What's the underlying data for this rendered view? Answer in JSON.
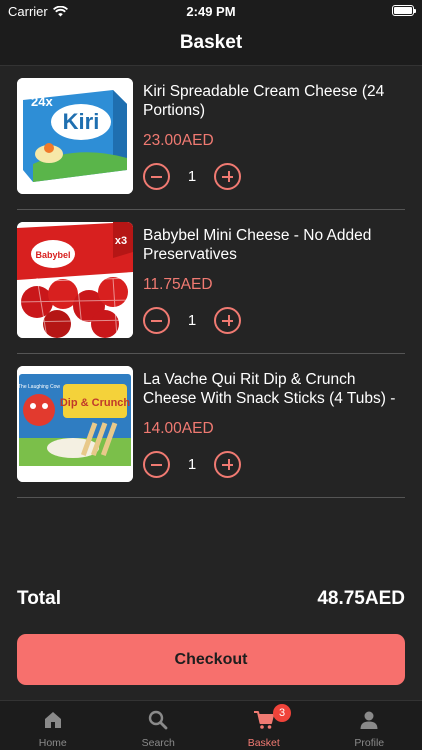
{
  "status_bar": {
    "carrier": "Carrier",
    "time": "2:49 PM"
  },
  "header": {
    "title": "Basket"
  },
  "items": [
    {
      "name": "Kiri Spreadable Cream Cheese (24 Portions)",
      "price": "23.00AED",
      "quantity": "1",
      "image_text": "Kiri",
      "image_badge": "24x"
    },
    {
      "name": "Babybel Mini Cheese - No Added Preservatives",
      "price": "11.75AED",
      "quantity": "1",
      "image_text": "Babybel",
      "image_badge": "x3"
    },
    {
      "name": "La Vache Qui Rit Dip & Crunch Cheese With Snack Sticks (4 Tubs) -",
      "price": "14.00AED",
      "quantity": "1",
      "image_text": "Dip & Crunch",
      "image_brand": "The Laughing Cow"
    }
  ],
  "summary": {
    "total_label": "Total",
    "total_value": "48.75AED"
  },
  "checkout_label": "Checkout",
  "tabs": [
    {
      "label": "Home",
      "icon": "home-icon"
    },
    {
      "label": "Search",
      "icon": "search-icon"
    },
    {
      "label": "Basket",
      "icon": "cart-icon",
      "badge": "3",
      "active": true
    },
    {
      "label": "Profile",
      "icon": "profile-icon"
    }
  ],
  "colors": {
    "background": "#242424",
    "bar": "#1c1c1c",
    "accent": "#f07a72",
    "checkout": "#f7706d",
    "badge": "#f0433a"
  }
}
